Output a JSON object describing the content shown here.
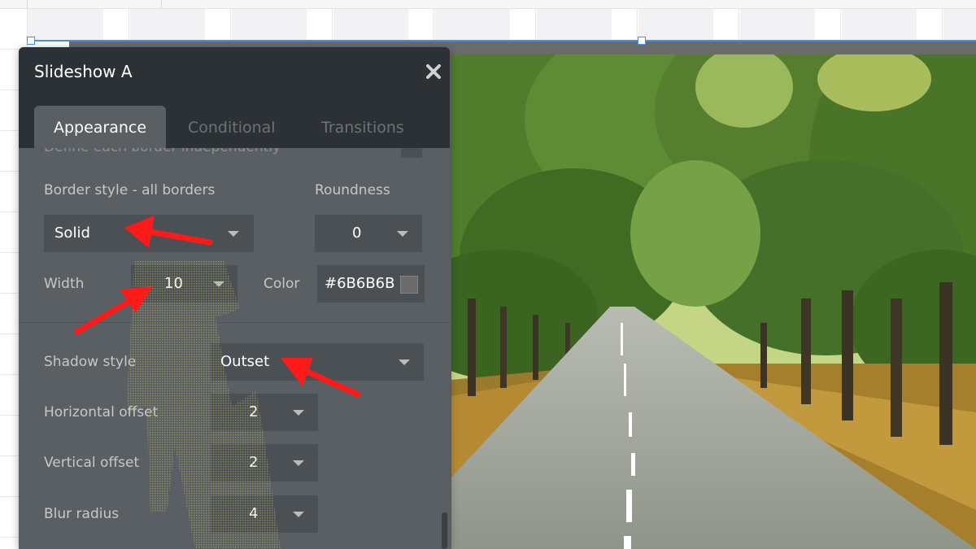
{
  "panel": {
    "title": "Slideshow A",
    "close_icon": "close-icon",
    "tabs": [
      {
        "label": "Appearance",
        "active": true
      },
      {
        "label": "Conditional",
        "active": false
      },
      {
        "label": "Transitions",
        "active": false
      }
    ],
    "cutoff_row_label": "Define each border independently",
    "border_style": {
      "label": "Border style - all borders",
      "value": "Solid"
    },
    "roundness": {
      "label": "Roundness",
      "value": "0"
    },
    "width": {
      "label": "Width",
      "value": "10"
    },
    "color": {
      "label": "Color",
      "value": "#6B6B6B"
    },
    "shadow_style": {
      "label": "Shadow style",
      "value": "Outset"
    },
    "horizontal_offset": {
      "label": "Horizontal offset",
      "value": "2"
    },
    "vertical_offset": {
      "label": "Vertical offset",
      "value": "2"
    },
    "blur_radius": {
      "label": "Blur radius",
      "value": "4"
    }
  },
  "colors": {
    "panel_bg": "#5a5f63",
    "header_bg": "#2c3135",
    "field_bg": "#4b5054",
    "selection_blue": "#4a90e2",
    "annotation_red": "#ff1a1a",
    "border_color": "#6B6B6B"
  },
  "canvas": {
    "element": "slideshow",
    "image_subject": "tree-lined road in forest"
  }
}
